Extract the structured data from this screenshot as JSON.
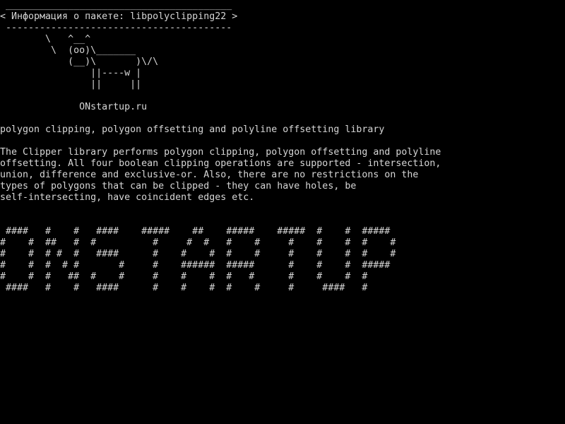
{
  "terminal": {
    "colors": {
      "background": "#000000",
      "foreground": "#d6d6d6"
    },
    "speech_bubble": {
      "top_border": " ________________________________________",
      "text": "< Информация о пакете: libpolyclipping22 >",
      "bottom_border": " ----------------------------------------"
    },
    "cow": [
      "        \\   ^__^",
      "         \\  (oo)\\_______",
      "            (__)\\       )\\/\\",
      "                ||----w |",
      "                ||     ||"
    ],
    "site": "              ONstartup.ru",
    "summary": "polygon clipping, polygon offsetting and polyline offsetting library",
    "description": [
      "The Clipper library performs polygon clipping, polygon offsetting and polyline",
      "offsetting. All four boolean clipping operations are supported - intersection,",
      "union, difference and exclusive-or. Also, there are no restrictions on the",
      "types of polygons that can be clipped - they can have holes, be",
      "self-intersecting, have coincident edges etc."
    ],
    "banner": [
      " ####   #    #   ####    #####    ##    #####    #####  #    #  #####",
      "#    #  ##   #  #          #     #  #   #    #     #    #    #  #    #",
      "#    #  # #  #   ####      #    #    #  #    #     #    #    #  #    #",
      "#    #  #  # #       #     #    ######  #####      #    #    #  #####",
      "#    #  #   ##  #    #     #    #    #  #   #      #    #    #  #",
      " ####   #    #   ####      #    #    #  #    #     #     ####   #"
    ]
  }
}
